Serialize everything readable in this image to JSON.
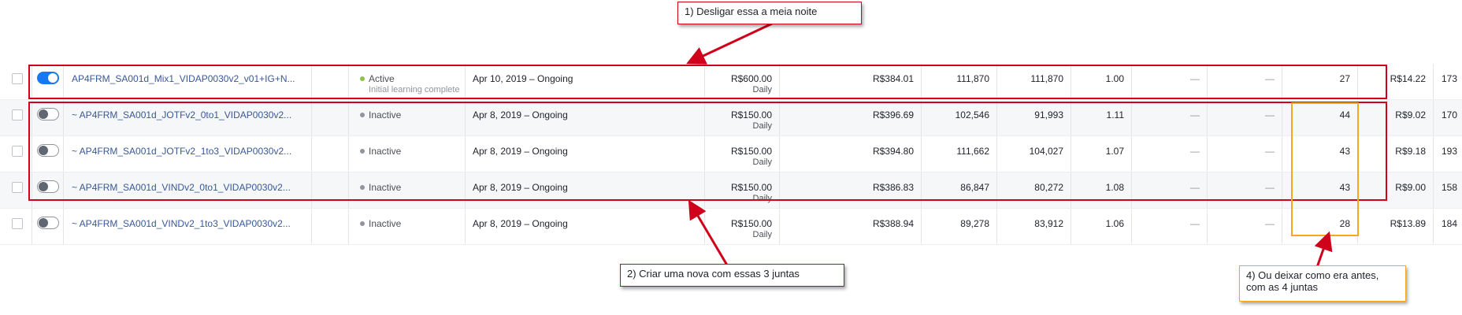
{
  "rows": [
    {
      "name": "AP4FRM_SA001d_Mix1_VIDAP0030v2_v01+IG+N...",
      "active": true,
      "status": "Active",
      "substatus": "Initial learning complete",
      "schedule": "Apr 10, 2019 – Ongoing",
      "budget": "R$600.00",
      "budget_period": "Daily",
      "spent": "R$384.01",
      "reach": "111,870",
      "impressions": "111,870",
      "frequency": "1.00",
      "c1": "—",
      "c2": "—",
      "results": "27",
      "cpr": "R$14.22",
      "last": "173"
    },
    {
      "name": "~ AP4FRM_SA001d_JOTFv2_0to1_VIDAP0030v2...",
      "active": false,
      "status": "Inactive",
      "substatus": "",
      "schedule": "Apr 8, 2019 – Ongoing",
      "budget": "R$150.00",
      "budget_period": "Daily",
      "spent": "R$396.69",
      "reach": "102,546",
      "impressions": "91,993",
      "frequency": "1.11",
      "c1": "—",
      "c2": "—",
      "results": "44",
      "cpr": "R$9.02",
      "last": "170"
    },
    {
      "name": "~ AP4FRM_SA001d_JOTFv2_1to3_VIDAP0030v2...",
      "active": false,
      "status": "Inactive",
      "substatus": "",
      "schedule": "Apr 8, 2019 – Ongoing",
      "budget": "R$150.00",
      "budget_period": "Daily",
      "spent": "R$394.80",
      "reach": "111,662",
      "impressions": "104,027",
      "frequency": "1.07",
      "c1": "—",
      "c2": "—",
      "results": "43",
      "cpr": "R$9.18",
      "last": "193"
    },
    {
      "name": "~ AP4FRM_SA001d_VINDv2_0to1_VIDAP0030v2...",
      "active": false,
      "status": "Inactive",
      "substatus": "",
      "schedule": "Apr 8, 2019 – Ongoing",
      "budget": "R$150.00",
      "budget_period": "Daily",
      "spent": "R$386.83",
      "reach": "86,847",
      "impressions": "80,272",
      "frequency": "1.08",
      "c1": "—",
      "c2": "—",
      "results": "43",
      "cpr": "R$9.00",
      "last": "158"
    },
    {
      "name": "~ AP4FRM_SA001d_VINDv2_1to3_VIDAP0030v2...",
      "active": false,
      "status": "Inactive",
      "substatus": "",
      "schedule": "Apr 8, 2019 – Ongoing",
      "budget": "R$150.00",
      "budget_period": "Daily",
      "spent": "R$388.94",
      "reach": "89,278",
      "impressions": "83,912",
      "frequency": "1.06",
      "c1": "—",
      "c2": "—",
      "results": "28",
      "cpr": "R$13.89",
      "last": "184"
    }
  ],
  "annotations": {
    "note1": "1) Desligar essa a meia noite",
    "note2": "2) Criar uma nova com essas 3 juntas",
    "note4_line1": "4) Ou deixar como era antes,",
    "note4_line2": "com as 4 juntas"
  },
  "colors": {
    "accent": "#1877f2",
    "annotation_red": "#d0021b",
    "annotation_orange": "#f5a623",
    "active_dot": "#8bc34a",
    "inactive_dot": "#90949c"
  }
}
